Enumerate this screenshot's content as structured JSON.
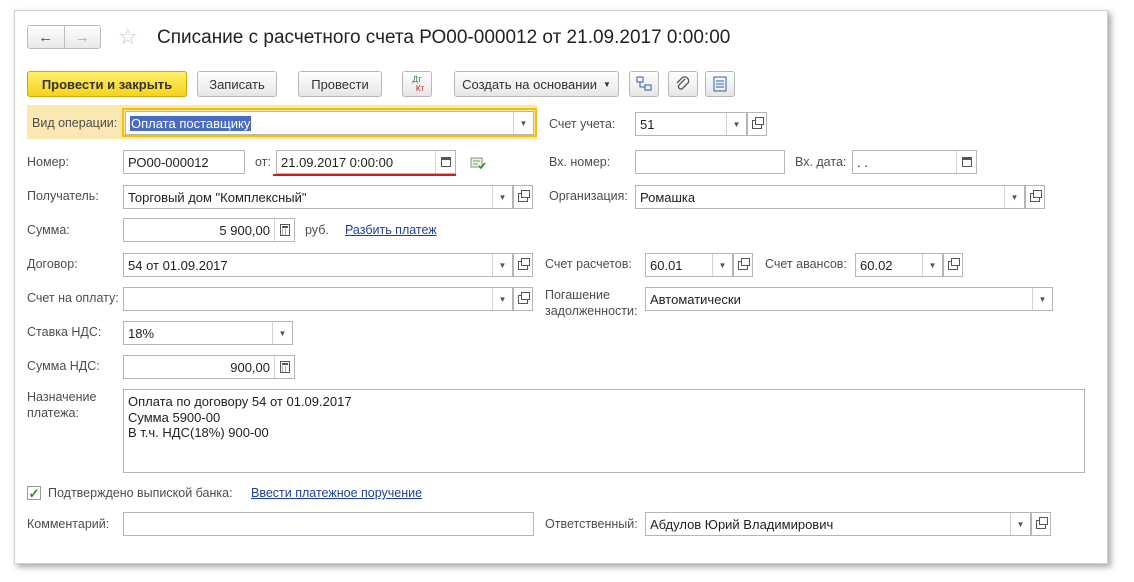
{
  "window": {
    "title": "Списание с расчетного счета РО00-000012 от 21.09.2017 0:00:00"
  },
  "nav": {
    "back": "←",
    "forward": "→"
  },
  "toolbar": {
    "post_close": "Провести и закрыть",
    "save": "Записать",
    "post": "Провести",
    "dt_kt_top": "Дт",
    "dt_kt_bottom": "Кт",
    "create_based": "Создать на основании"
  },
  "form": {
    "operation_type": {
      "label": "Вид операции:",
      "value": "Оплата поставщику"
    },
    "account": {
      "label": "Счет учета:",
      "value": "51"
    },
    "number": {
      "label": "Номер:",
      "value": "РО00-000012"
    },
    "date": {
      "label": "от:",
      "value": "21.09.2017  0:00:00"
    },
    "in_number": {
      "label": "Вх. номер:",
      "value": ""
    },
    "in_date": {
      "label": "Вх. дата:",
      "value": " .  ."
    },
    "recipient": {
      "label": "Получатель:",
      "value": "Торговый дом \"Комплексный\""
    },
    "organization": {
      "label": "Организация:",
      "value": "Ромашка"
    },
    "amount": {
      "label": "Сумма:",
      "value": "5 900,00",
      "currency": "руб.",
      "split_link": "Разбить платеж"
    },
    "contract": {
      "label": "Договор:",
      "value": "54 от 01.09.2017"
    },
    "settlement_account": {
      "label": "Счет расчетов:",
      "value": "60.01"
    },
    "advance_account": {
      "label": "Счет авансов:",
      "value": "60.02"
    },
    "invoice": {
      "label": "Счет на оплату:",
      "value": ""
    },
    "repayment": {
      "label_line1": "Погашение",
      "label_line2": "задолженности:",
      "value": "Автоматически"
    },
    "vat_rate": {
      "label": "Ставка НДС:",
      "value": "18%"
    },
    "vat_amount": {
      "label": "Сумма НДС:",
      "value": "900,00"
    },
    "purpose": {
      "label_line1": "Назначение",
      "label_line2": "платежа:",
      "lines": [
        "Оплата по договору 54 от 01.09.2017",
        "Сумма 5900-00",
        "В т.ч. НДС(18%) 900-00"
      ]
    },
    "confirmed": {
      "label": "Подтверждено выпиской банка:",
      "checked": true,
      "link": "Ввести платежное поручение"
    },
    "comment": {
      "label": "Комментарий:",
      "value": ""
    },
    "responsible": {
      "label": "Ответственный:",
      "value": "Абдулов Юрий Владимирович"
    }
  },
  "icons": {
    "dropdown": "▾",
    "calendar": "calendar-icon",
    "open": "open-form-icon",
    "calculator": "calculator-icon"
  },
  "colors": {
    "primary_button": "#f6d21e",
    "link": "#1d3f9e",
    "underline_highlight": "#d31d1d",
    "selection": "#4a6bc4"
  }
}
